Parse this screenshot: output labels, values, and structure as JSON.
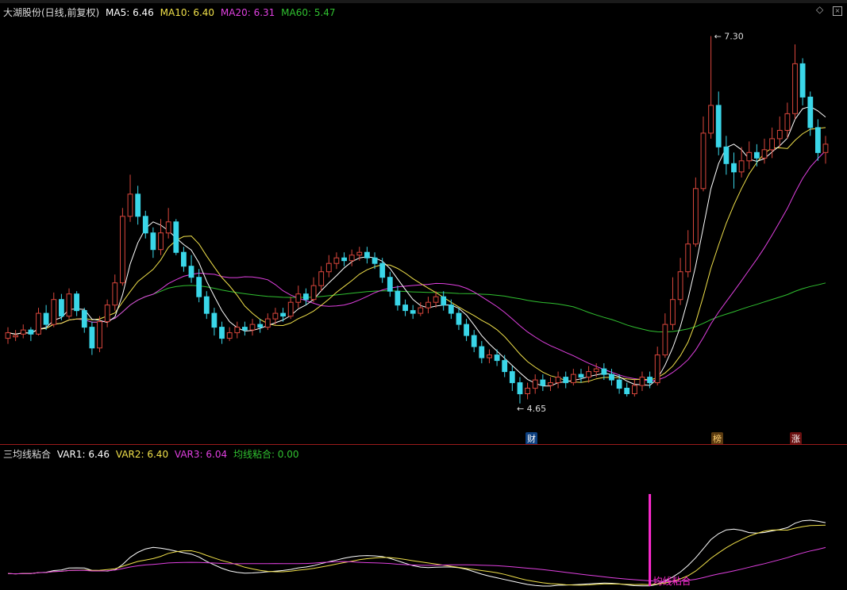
{
  "colors": {
    "bg": "#000000",
    "up": "#d9463c",
    "down": "#3ad6e8",
    "ma5": "#ffffff",
    "ma10": "#f0e04a",
    "ma20": "#e040e0",
    "ma60": "#30c030",
    "signal": "#ff2ad0",
    "border": "#9b1b1b"
  },
  "main_panel": {
    "title": "大湖股份(日线,前复权)",
    "legend": [
      {
        "label": "MA5: 6.46",
        "color": "#ffffff"
      },
      {
        "label": "MA10: 6.40",
        "color": "#f0e04a"
      },
      {
        "label": "MA20: 6.31",
        "color": "#e040e0"
      },
      {
        "label": "MA60: 5.47",
        "color": "#30c030"
      }
    ],
    "high_label": "7.30",
    "low_label": "4.65",
    "badges": [
      {
        "text": "财",
        "color": "#3aa0ff"
      },
      {
        "text": "榜",
        "color": "#e0a040"
      },
      {
        "text": "涨",
        "color": "#ff5050"
      }
    ],
    "icons": [
      "diamond-icon",
      "close-box-icon"
    ]
  },
  "sub_panel": {
    "title": "三均线粘合",
    "legend": [
      {
        "label": "VAR1: 6.46",
        "color": "#ffffff"
      },
      {
        "label": "VAR2: 6.40",
        "color": "#f0e04a"
      },
      {
        "label": "VAR3: 6.04",
        "color": "#e040e0"
      },
      {
        "label": "均线粘合: 0.00",
        "color": "#30c030"
      }
    ],
    "signal_label": "均线粘合"
  },
  "chart_data": {
    "type": "candlestick",
    "y_range": [
      4.5,
      7.4
    ],
    "candles": [
      [
        5.12,
        5.16,
        5.08,
        5.2
      ],
      [
        5.13,
        5.14,
        5.1,
        5.18
      ],
      [
        5.15,
        5.18,
        5.12,
        5.22
      ],
      [
        5.18,
        5.15,
        5.1,
        5.2
      ],
      [
        5.15,
        5.3,
        5.14,
        5.34
      ],
      [
        5.3,
        5.22,
        5.18,
        5.36
      ],
      [
        5.22,
        5.4,
        5.2,
        5.45
      ],
      [
        5.4,
        5.28,
        5.25,
        5.44
      ],
      [
        5.28,
        5.44,
        5.26,
        5.48
      ],
      [
        5.44,
        5.32,
        5.28,
        5.46
      ],
      [
        5.32,
        5.2,
        5.16,
        5.34
      ],
      [
        5.2,
        5.05,
        5.0,
        5.24
      ],
      [
        5.05,
        5.24,
        5.02,
        5.28
      ],
      [
        5.24,
        5.36,
        5.2,
        5.4
      ],
      [
        5.36,
        5.52,
        5.32,
        5.58
      ],
      [
        5.52,
        6.0,
        5.5,
        6.06
      ],
      [
        6.0,
        6.16,
        5.96,
        6.3
      ],
      [
        6.16,
        6.0,
        5.94,
        6.22
      ],
      [
        6.0,
        5.88,
        5.84,
        6.04
      ],
      [
        5.88,
        5.76,
        5.7,
        5.92
      ],
      [
        5.76,
        5.88,
        5.72,
        5.98
      ],
      [
        5.88,
        5.96,
        5.84,
        6.06
      ],
      [
        5.96,
        5.74,
        5.72,
        5.98
      ],
      [
        5.74,
        5.64,
        5.6,
        5.78
      ],
      [
        5.64,
        5.56,
        5.52,
        5.72
      ],
      [
        5.56,
        5.42,
        5.38,
        5.62
      ],
      [
        5.42,
        5.3,
        5.26,
        5.46
      ],
      [
        5.3,
        5.2,
        5.14,
        5.34
      ],
      [
        5.2,
        5.12,
        5.08,
        5.24
      ],
      [
        5.12,
        5.16,
        5.1,
        5.2
      ],
      [
        5.16,
        5.2,
        5.12,
        5.24
      ],
      [
        5.2,
        5.18,
        5.14,
        5.24
      ],
      [
        5.18,
        5.22,
        5.14,
        5.26
      ],
      [
        5.22,
        5.2,
        5.16,
        5.26
      ],
      [
        5.2,
        5.26,
        5.18,
        5.3
      ],
      [
        5.26,
        5.3,
        5.22,
        5.34
      ],
      [
        5.3,
        5.28,
        5.24,
        5.34
      ],
      [
        5.28,
        5.38,
        5.26,
        5.42
      ],
      [
        5.38,
        5.44,
        5.34,
        5.5
      ],
      [
        5.44,
        5.4,
        5.36,
        5.48
      ],
      [
        5.4,
        5.5,
        5.38,
        5.56
      ],
      [
        5.5,
        5.6,
        5.46,
        5.64
      ],
      [
        5.6,
        5.66,
        5.56,
        5.72
      ],
      [
        5.66,
        5.7,
        5.62,
        5.74
      ],
      [
        5.7,
        5.68,
        5.64,
        5.74
      ],
      [
        5.68,
        5.72,
        5.64,
        5.76
      ],
      [
        5.72,
        5.74,
        5.68,
        5.78
      ],
      [
        5.74,
        5.7,
        5.66,
        5.78
      ],
      [
        5.7,
        5.66,
        5.62,
        5.74
      ],
      [
        5.66,
        5.56,
        5.52,
        5.7
      ],
      [
        5.56,
        5.46,
        5.42,
        5.6
      ],
      [
        5.46,
        5.36,
        5.32,
        5.5
      ],
      [
        5.36,
        5.32,
        5.28,
        5.4
      ],
      [
        5.32,
        5.3,
        5.26,
        5.36
      ],
      [
        5.3,
        5.34,
        5.28,
        5.38
      ],
      [
        5.34,
        5.38,
        5.3,
        5.42
      ],
      [
        5.38,
        5.42,
        5.34,
        5.46
      ],
      [
        5.42,
        5.36,
        5.32,
        5.46
      ],
      [
        5.36,
        5.3,
        5.26,
        5.4
      ],
      [
        5.3,
        5.22,
        5.18,
        5.34
      ],
      [
        5.22,
        5.14,
        5.1,
        5.26
      ],
      [
        5.14,
        5.06,
        5.02,
        5.18
      ],
      [
        5.06,
        4.98,
        4.94,
        5.1
      ],
      [
        4.98,
        5.0,
        4.94,
        5.04
      ],
      [
        5.0,
        4.96,
        4.92,
        5.04
      ],
      [
        4.96,
        4.88,
        4.84,
        5.0
      ],
      [
        4.88,
        4.8,
        4.74,
        4.92
      ],
      [
        4.8,
        4.72,
        4.65,
        4.84
      ],
      [
        4.72,
        4.76,
        4.68,
        4.8
      ],
      [
        4.76,
        4.82,
        4.72,
        4.86
      ],
      [
        4.82,
        4.78,
        4.74,
        4.86
      ],
      [
        4.78,
        4.8,
        4.74,
        4.84
      ],
      [
        4.8,
        4.84,
        4.76,
        4.88
      ],
      [
        4.84,
        4.8,
        4.76,
        4.88
      ],
      [
        4.8,
        4.86,
        4.78,
        4.9
      ],
      [
        4.86,
        4.84,
        4.8,
        4.9
      ],
      [
        4.84,
        4.88,
        4.8,
        4.92
      ],
      [
        4.88,
        4.9,
        4.84,
        4.94
      ],
      [
        4.9,
        4.86,
        4.82,
        4.94
      ],
      [
        4.86,
        4.82,
        4.78,
        4.9
      ],
      [
        4.82,
        4.76,
        4.72,
        4.86
      ],
      [
        4.76,
        4.72,
        4.7,
        4.8
      ],
      [
        4.72,
        4.78,
        4.7,
        4.82
      ],
      [
        4.78,
        4.84,
        4.74,
        4.88
      ],
      [
        4.84,
        4.8,
        4.76,
        4.88
      ],
      [
        4.8,
        5.0,
        4.78,
        5.06
      ],
      [
        5.0,
        5.22,
        4.98,
        5.3
      ],
      [
        5.22,
        5.4,
        5.18,
        5.56
      ],
      [
        5.4,
        5.6,
        5.36,
        5.7
      ],
      [
        5.6,
        5.8,
        5.56,
        5.9
      ],
      [
        5.8,
        6.2,
        5.78,
        6.28
      ],
      [
        6.2,
        6.6,
        6.18,
        6.72
      ],
      [
        6.6,
        6.8,
        6.56,
        7.3
      ],
      [
        6.8,
        6.5,
        6.44,
        6.9
      ],
      [
        6.5,
        6.38,
        6.3,
        6.58
      ],
      [
        6.38,
        6.32,
        6.2,
        6.46
      ],
      [
        6.32,
        6.4,
        6.28,
        6.5
      ],
      [
        6.4,
        6.46,
        6.34,
        6.54
      ],
      [
        6.46,
        6.42,
        6.36,
        6.52
      ],
      [
        6.42,
        6.48,
        6.38,
        6.56
      ],
      [
        6.48,
        6.56,
        6.42,
        6.64
      ],
      [
        6.56,
        6.62,
        6.5,
        6.72
      ],
      [
        6.62,
        6.74,
        6.56,
        6.82
      ],
      [
        6.74,
        7.1,
        6.7,
        7.24
      ],
      [
        7.1,
        6.86,
        6.8,
        7.14
      ],
      [
        6.86,
        6.64,
        6.58,
        6.9
      ],
      [
        6.64,
        6.46,
        6.4,
        6.7
      ],
      [
        6.46,
        6.52,
        6.38,
        6.58
      ]
    ]
  }
}
